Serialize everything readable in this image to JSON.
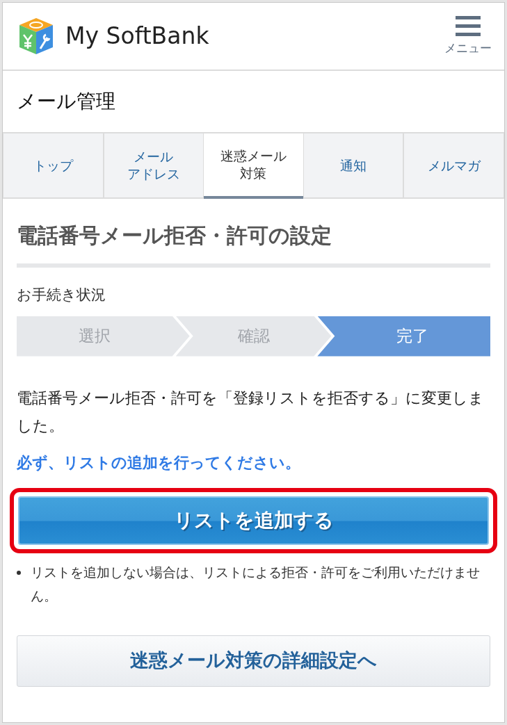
{
  "header": {
    "brand": "My SoftBank",
    "menu_label": "メニュー"
  },
  "page_title": "メール管理",
  "tabs": [
    {
      "lines": [
        "トップ"
      ],
      "selected": false
    },
    {
      "lines": [
        "メール",
        "アドレス"
      ],
      "selected": false
    },
    {
      "lines": [
        "迷惑メール",
        "対策"
      ],
      "selected": true
    },
    {
      "lines": [
        "通知"
      ],
      "selected": false
    },
    {
      "lines": [
        "メルマガ"
      ],
      "selected": false
    }
  ],
  "heading": "電話番号メール拒否・許可の設定",
  "progress": {
    "label": "お手続き状況",
    "steps": [
      {
        "label": "選択",
        "selected": false
      },
      {
        "label": "確認",
        "selected": false
      },
      {
        "label": "完了",
        "selected": true
      }
    ]
  },
  "message": "電話番号メール拒否・許可を「登録リストを拒否する」に変更しました。",
  "notice": "必ず、リストの追加を行ってください。",
  "primary_button": {
    "label": "リストを追加する",
    "highlighted": true
  },
  "notes": [
    "リストを追加しない場合は、リストによる拒否・許可をご利用いただけません。"
  ],
  "secondary_button": {
    "label": "迷惑メール対策の詳細設定へ"
  }
}
